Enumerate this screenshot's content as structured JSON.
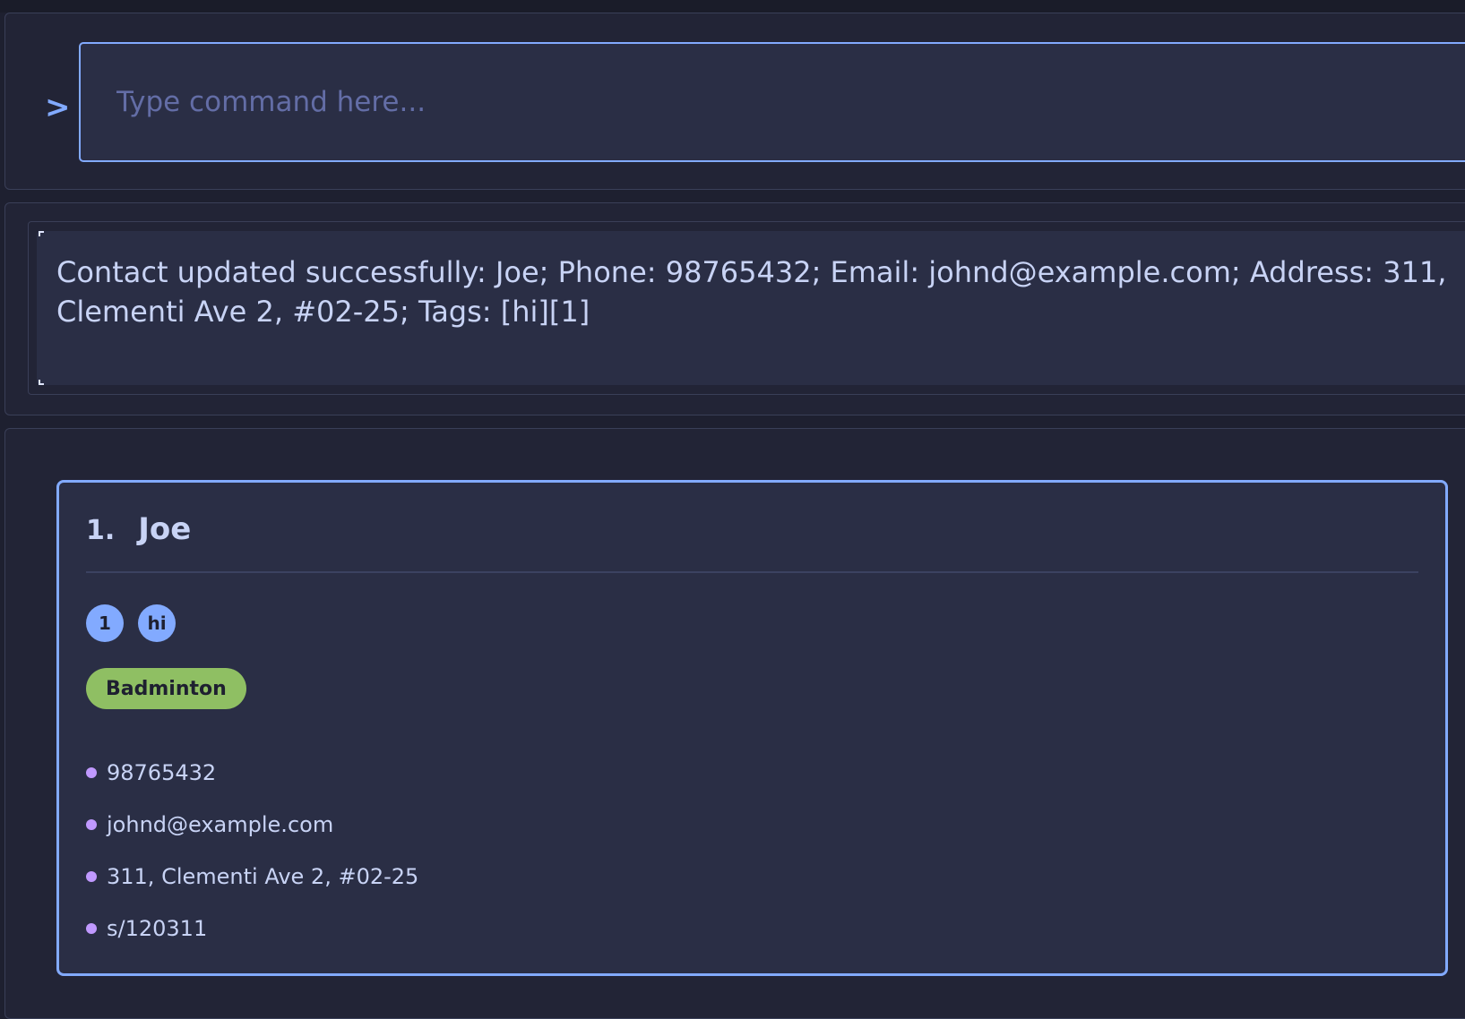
{
  "command": {
    "prompt_symbol": ">",
    "placeholder": "Type command here..."
  },
  "result": {
    "message": "Contact updated successfully: Joe; Phone: 98765432; Email: johnd@example.com; Address: 311, Clementi Ave 2, #02-25; Tags: [hi][1]"
  },
  "contacts": [
    {
      "index": "1.",
      "name": "Joe",
      "tags": [
        "1",
        "hi"
      ],
      "group": "Badminton",
      "phone": "98765432",
      "email": "johnd@example.com",
      "address": "311, Clementi Ave 2, #02-25",
      "extra": "s/120311"
    }
  ],
  "colors": {
    "accent": "#82aaff",
    "group_tag": "#8fbf63",
    "bullet": "#c099ff",
    "background": "#1e2030",
    "card": "#2a2e45"
  }
}
